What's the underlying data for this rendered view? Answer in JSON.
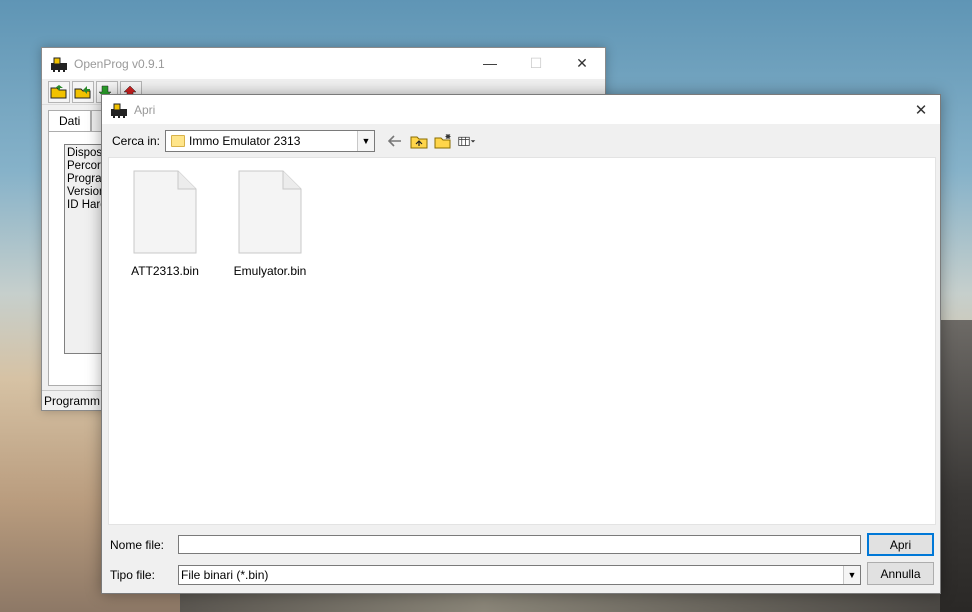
{
  "main_window": {
    "title": "OpenProg v0.9.1",
    "minimize": "—",
    "maximize": "☐",
    "close": "✕",
    "tabs": [
      "Dati",
      "D"
    ],
    "info_lines": [
      "Disposit",
      "Percors",
      "Program",
      "Version",
      "ID Hard"
    ],
    "status": "Programm"
  },
  "dialog": {
    "title": "Apri",
    "close": "✕",
    "look_in_label": "Cerca in:",
    "look_in_value": "Immo Emulator 2313",
    "files": [
      {
        "name": "ATT2313.bin"
      },
      {
        "name": "Emulyator.bin"
      }
    ],
    "filename_label": "Nome file:",
    "filename_value": "",
    "filetype_label": "Tipo file:",
    "filetype_value": "File binari (*.bin)",
    "open_button": "Apri",
    "cancel_button": "Annulla"
  },
  "icons": {
    "back": "back-arrow-icon",
    "up": "up-folder-icon",
    "new_folder": "new-folder-icon",
    "view_menu": "view-menu-icon",
    "app": "openprog-icon",
    "file": "document-icon"
  },
  "colors": {
    "accent": "#0078d7",
    "folder": "#ffe58a"
  }
}
